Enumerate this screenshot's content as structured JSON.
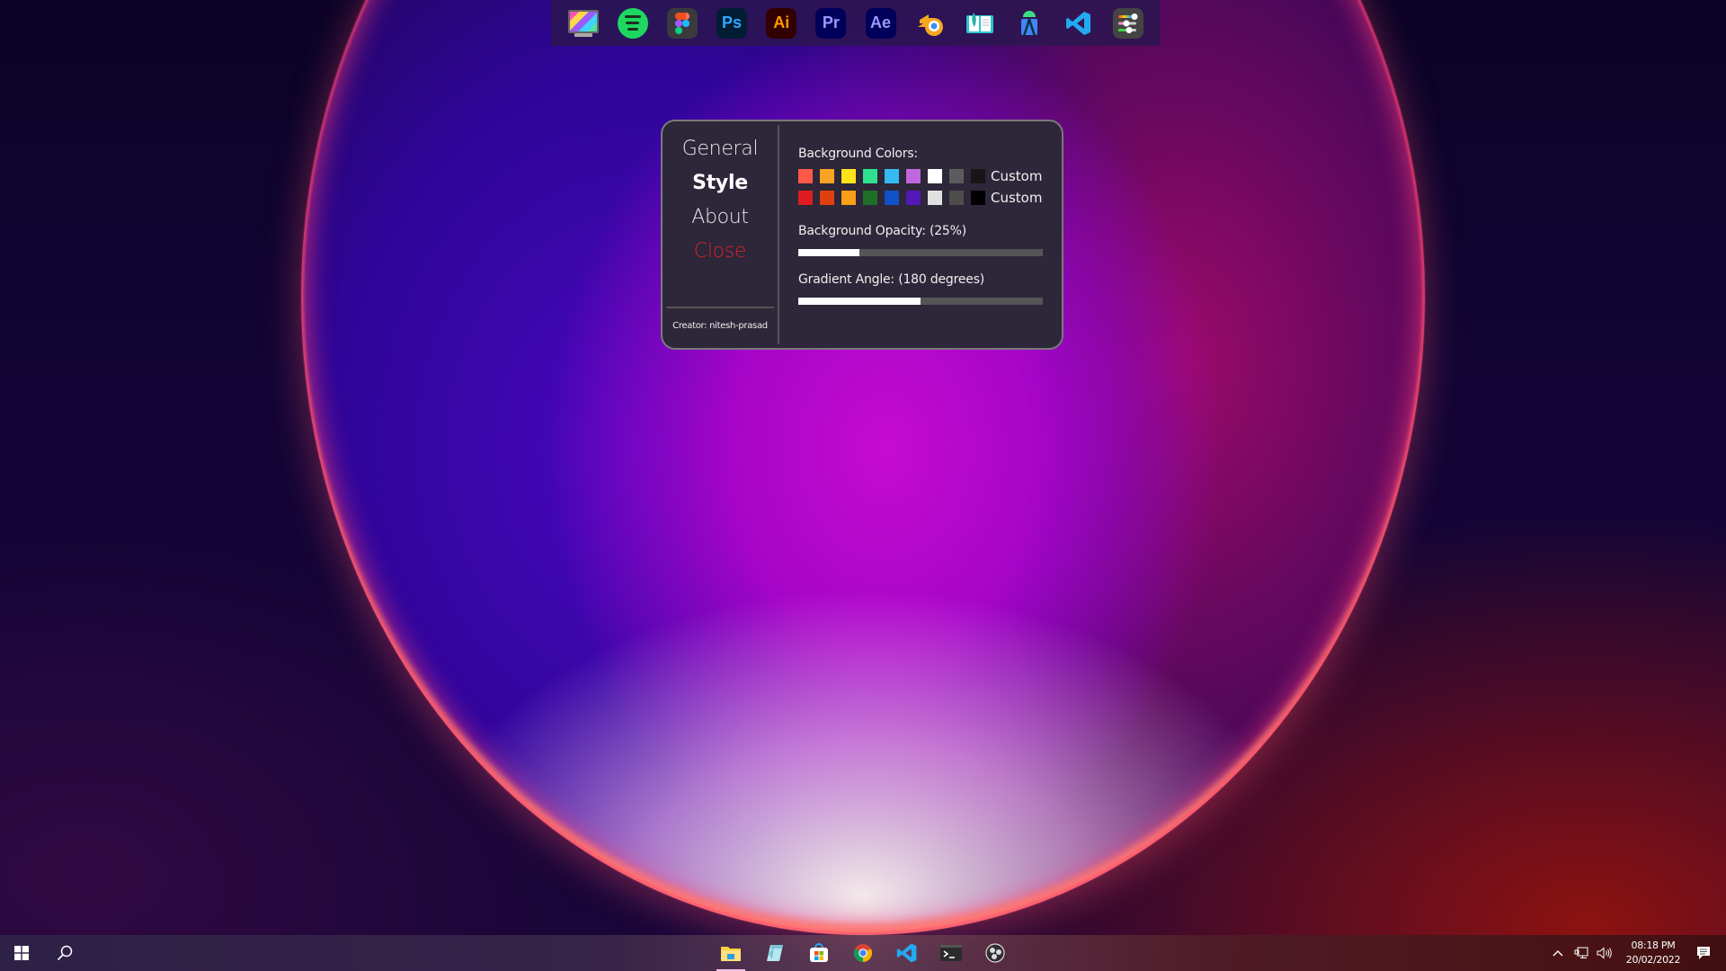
{
  "dock": {
    "icons": [
      {
        "name": "display-settings",
        "label": ""
      },
      {
        "name": "spotify",
        "label": ""
      },
      {
        "name": "figma",
        "label": ""
      },
      {
        "name": "photoshop",
        "label": "Ps"
      },
      {
        "name": "illustrator",
        "label": "Ai"
      },
      {
        "name": "premiere-pro",
        "label": "Pr"
      },
      {
        "name": "after-effects",
        "label": "Ae"
      },
      {
        "name": "blender",
        "label": ""
      },
      {
        "name": "reading-book",
        "label": ""
      },
      {
        "name": "android-studio",
        "label": ""
      },
      {
        "name": "vscode",
        "label": ""
      },
      {
        "name": "dock-settings",
        "label": ""
      }
    ]
  },
  "settings": {
    "nav": {
      "general": "General",
      "style": "Style",
      "about": "About",
      "close": "Close",
      "active": "Style"
    },
    "creator": "Creator: nitesh-prasad",
    "background_colors": {
      "label": "Background Colors:",
      "row1": [
        "#ff5a47",
        "#f7a325",
        "#ffe31a",
        "#2fe18e",
        "#33bbf2",
        "#bf67dd",
        "#ffffff",
        "#5c5c5c",
        "#161616"
      ],
      "row2": [
        "#dd1c1f",
        "#e0400f",
        "#f8a01a",
        "#1f7027",
        "#1051c9",
        "#5318b5",
        "#e0e0e0",
        "#4d4d4d",
        "#000000"
      ],
      "custom_label_1": "Custom",
      "custom_label_2": "Custom"
    },
    "opacity": {
      "label": "Background Opacity: (25%)",
      "value_percent": 25
    },
    "gradient_angle": {
      "label": "Gradient Angle: (180 degrees)",
      "value_degrees": 180,
      "max_degrees": 360
    }
  },
  "taskbar": {
    "start": "start",
    "search": "search",
    "apps": [
      "file-explorer",
      "notepad",
      "microsoft-store",
      "chrome",
      "vscode",
      "terminal",
      "obs-studio"
    ],
    "tray": {
      "time": "08:18 PM",
      "date": "20/02/2022"
    }
  },
  "colors": {
    "panel_bg": "#2e2639",
    "panel_border": "#7a7a7a",
    "close_red": "#d0242a"
  }
}
